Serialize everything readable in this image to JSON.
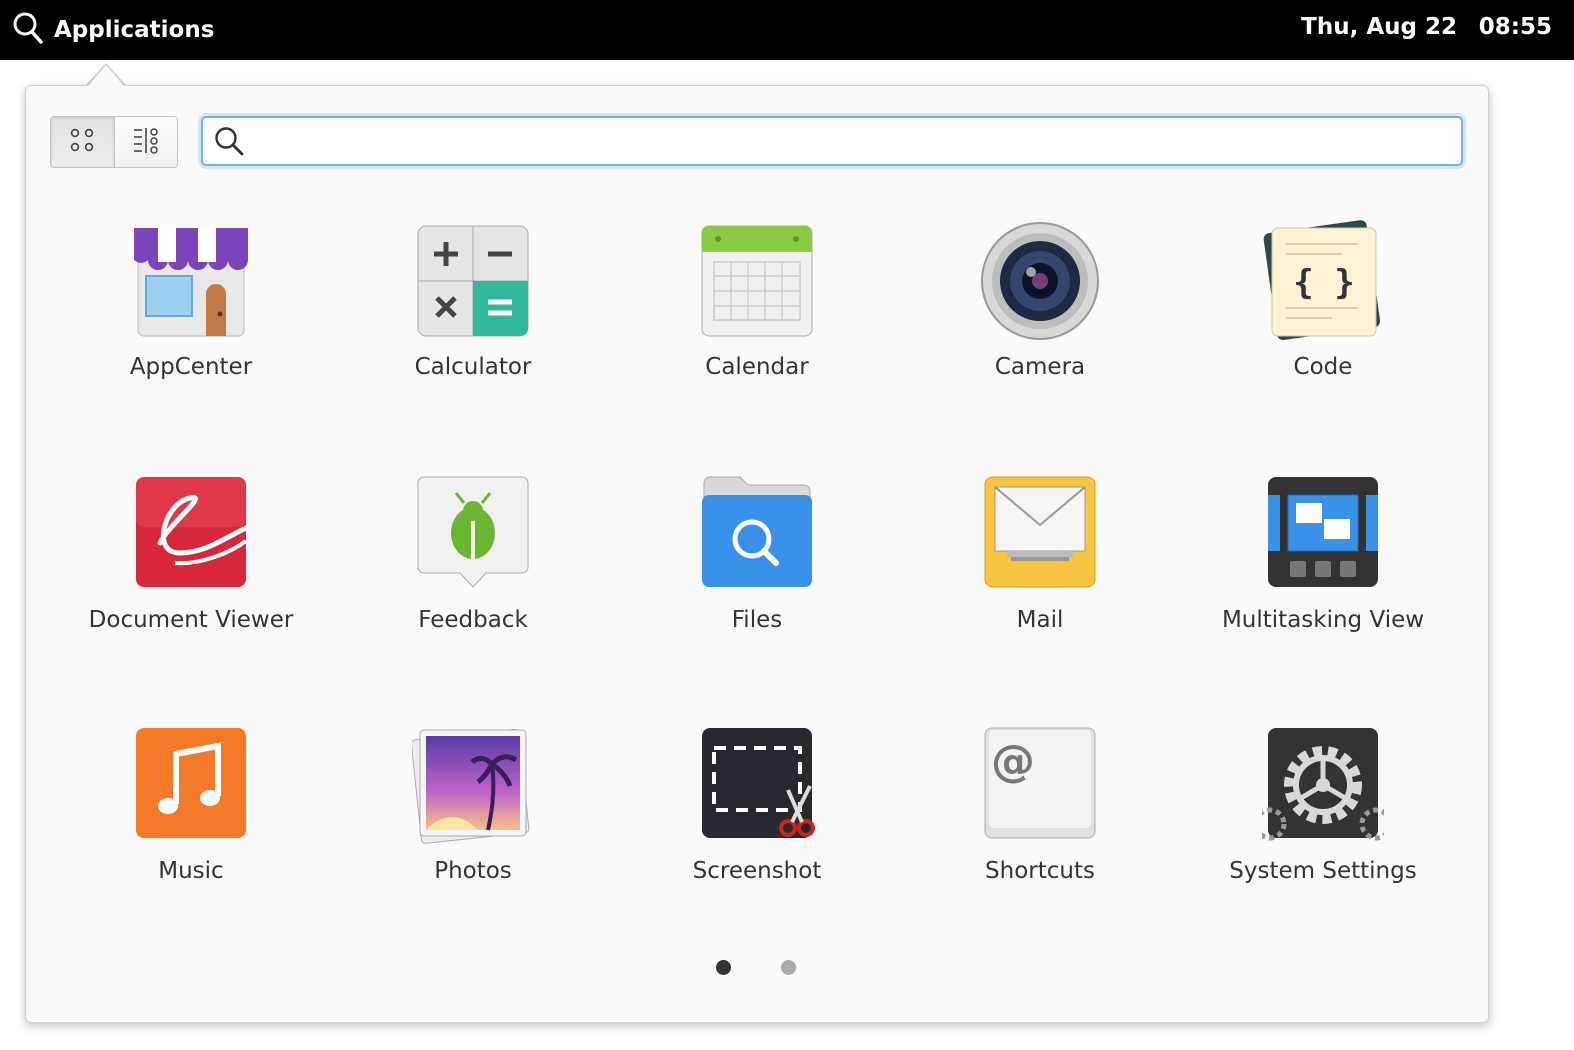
{
  "panel": {
    "title": "Applications",
    "date": "Thu, Aug 22",
    "time": "08:55"
  },
  "search": {
    "value": "",
    "placeholder": ""
  },
  "view_switcher": {
    "active": "grid",
    "options": [
      "grid",
      "category"
    ]
  },
  "apps": [
    {
      "label": "AppCenter",
      "icon": "appcenter-icon"
    },
    {
      "label": "Calculator",
      "icon": "calculator-icon"
    },
    {
      "label": "Calendar",
      "icon": "calendar-icon"
    },
    {
      "label": "Camera",
      "icon": "camera-icon"
    },
    {
      "label": "Code",
      "icon": "code-icon"
    },
    {
      "label": "Document Viewer",
      "icon": "document-viewer-icon"
    },
    {
      "label": "Feedback",
      "icon": "feedback-icon"
    },
    {
      "label": "Files",
      "icon": "files-icon"
    },
    {
      "label": "Mail",
      "icon": "mail-icon"
    },
    {
      "label": "Multitasking View",
      "icon": "multitasking-view-icon"
    },
    {
      "label": "Music",
      "icon": "music-icon"
    },
    {
      "label": "Photos",
      "icon": "photos-icon"
    },
    {
      "label": "Screenshot",
      "icon": "screenshot-icon"
    },
    {
      "label": "Shortcuts",
      "icon": "shortcuts-icon"
    },
    {
      "label": "System Settings",
      "icon": "system-settings-icon"
    }
  ],
  "pagination": {
    "current_page": 1,
    "total_pages": 2
  },
  "colors": {
    "panel_bg": "#000000",
    "search_focus": "#6fb0ef",
    "dot_active": "#333333",
    "dot_inactive": "#aaaaaa"
  }
}
